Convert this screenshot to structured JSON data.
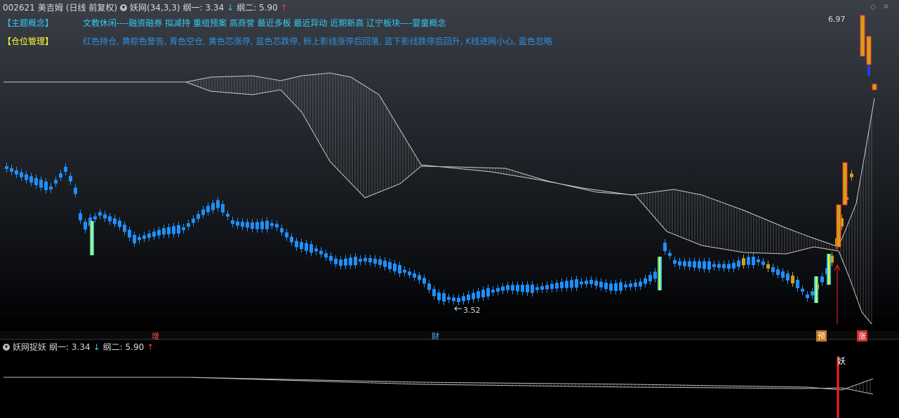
{
  "header": {
    "stock_code": "002621",
    "stock_name": "美吉姆",
    "period": "(日线 前复权)",
    "indicator_name": "妖网(34,3,3)",
    "line1_label": "纲一: 3.34",
    "line1_arrow": "↓",
    "line2_label": "纲二: 5.90",
    "line2_arrow": "↑"
  },
  "theme": {
    "label": "【主题概念】",
    "text": "文教休闲----融资融券 拟减持 重组预案 高商誉 最近多板 最近异动 近期新高 辽宁板块----婴童概念"
  },
  "position": {
    "label": "【仓位管理】",
    "text": "红色持仓, 黄棕色警告, 青色空仓, 黄色芯涨停, 蓝色芯跌停, 粉上影线涨停后回落, 蓝下影线跌停后回升, K线进网小心, 蓝色忽略"
  },
  "price_labels": {
    "high": "6.97",
    "low": "3.52"
  },
  "markers": {
    "m1": "增",
    "m2": "财",
    "m3": "预",
    "m4": "涨"
  },
  "sub_panel": {
    "title": "妖网捉妖",
    "line1_label": "纲一: 3.34",
    "line1_arrow": "↓",
    "line2_label": "纲二: 5.90",
    "line2_arrow": "↑",
    "signal": "妖"
  },
  "colors": {
    "up_red": "#ff3333",
    "down_blue": "#1e90ff",
    "cyan": "#33c8f0",
    "gold": "#d4a017",
    "yellow": "#ffff00",
    "net_line": "#bbbbbb"
  }
}
